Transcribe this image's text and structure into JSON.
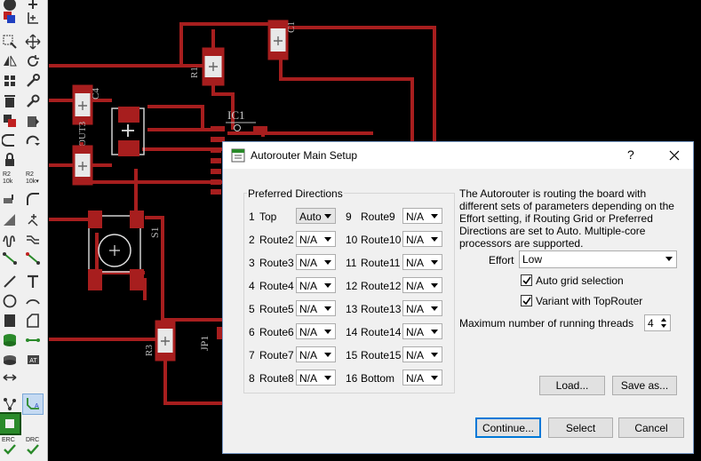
{
  "canvas": {
    "parts": {
      "c1": "C1",
      "r1": "R1",
      "c4": "C4",
      "out3": "OUT3",
      "ic1": "IC1",
      "s1": "S1",
      "r3": "R3",
      "jp1": "JP1"
    }
  },
  "toolbar": {
    "r2_label": "R2\n10k",
    "erc": "ERC",
    "drc": "DRC"
  },
  "dialog": {
    "title": "Autorouter Main Setup",
    "help": "?",
    "close": "✕",
    "group_title": "Preferred Directions",
    "directions_left": [
      {
        "num": "1",
        "name": "Top",
        "value": "Auto"
      },
      {
        "num": "2",
        "name": "Route2",
        "value": "N/A"
      },
      {
        "num": "3",
        "name": "Route3",
        "value": "N/A"
      },
      {
        "num": "4",
        "name": "Route4",
        "value": "N/A"
      },
      {
        "num": "5",
        "name": "Route5",
        "value": "N/A"
      },
      {
        "num": "6",
        "name": "Route6",
        "value": "N/A"
      },
      {
        "num": "7",
        "name": "Route7",
        "value": "N/A"
      },
      {
        "num": "8",
        "name": "Route8",
        "value": "N/A"
      }
    ],
    "directions_right": [
      {
        "num": "9",
        "name": "Route9",
        "value": "N/A"
      },
      {
        "num": "10",
        "name": "Route10",
        "value": "N/A"
      },
      {
        "num": "11",
        "name": "Route11",
        "value": "N/A"
      },
      {
        "num": "12",
        "name": "Route12",
        "value": "N/A"
      },
      {
        "num": "13",
        "name": "Route13",
        "value": "N/A"
      },
      {
        "num": "14",
        "name": "Route14",
        "value": "N/A"
      },
      {
        "num": "15",
        "name": "Route15",
        "value": "N/A"
      },
      {
        "num": "16",
        "name": "Bottom",
        "value": "N/A"
      }
    ],
    "description_lines": [
      "The Autorouter is routing the board with",
      "different sets of parameters depending on the",
      "Effort setting, if Routing Grid or Preferred",
      "Directions are set to Auto. Multiple-core",
      "processors are supported."
    ],
    "effort_label": "Effort",
    "effort_value": "Low",
    "auto_grid_label": "Auto grid selection",
    "auto_grid_checked": true,
    "variant_label": "Variant with TopRouter",
    "variant_checked": true,
    "threads_label": "Maximum number of running threads",
    "threads_value": "4",
    "load_button": "Load...",
    "saveas_button": "Save as...",
    "continue_button": "Continue...",
    "select_button": "Select",
    "cancel_button": "Cancel"
  }
}
